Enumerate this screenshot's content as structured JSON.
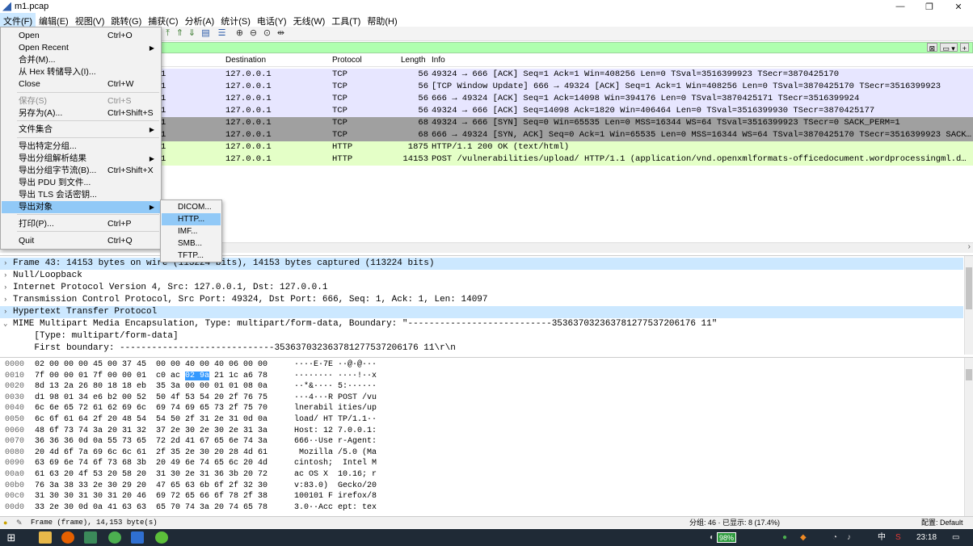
{
  "window": {
    "title": "m1.pcap"
  },
  "menubar": [
    "文件(F)",
    "编辑(E)",
    "视图(V)",
    "跳转(G)",
    "捕获(C)",
    "分析(A)",
    "统计(S)",
    "电话(Y)",
    "无线(W)",
    "工具(T)",
    "帮助(H)"
  ],
  "packet_list": {
    "columns": {
      "destination": "Destination",
      "protocol": "Protocol",
      "length": "Length",
      "info": "Info"
    },
    "rows": [
      {
        "frag": "1",
        "destination": "127.0.0.1",
        "protocol": "TCP",
        "length": "56",
        "info": "49324 → 666 [ACK] Seq=1 Ack=1 Win=408256 Len=0 TSval=3516399923 TSecr=3870425170",
        "color": "#e7e6ff"
      },
      {
        "frag": "1",
        "destination": "127.0.0.1",
        "protocol": "TCP",
        "length": "56",
        "info": "[TCP Window Update] 666 → 49324 [ACK] Seq=1 Ack=1 Win=408256 Len=0 TSval=3870425170 TSecr=3516399923",
        "color": "#e7e6ff"
      },
      {
        "frag": "1",
        "destination": "127.0.0.1",
        "protocol": "TCP",
        "length": "56",
        "info": "666 → 49324 [ACK] Seq=1 Ack=14098 Win=394176 Len=0 TSval=3870425171 TSecr=3516399924",
        "color": "#e7e6ff"
      },
      {
        "frag": "1",
        "destination": "127.0.0.1",
        "protocol": "TCP",
        "length": "56",
        "info": "49324 → 666 [ACK] Seq=14098 Ack=1820 Win=406464 Len=0 TSval=3516399930 TSecr=3870425177",
        "color": "#e7e6ff"
      },
      {
        "frag": "1",
        "destination": "127.0.0.1",
        "protocol": "TCP",
        "length": "68",
        "info": "49324 → 666 [SYN] Seq=0 Win=65535 Len=0 MSS=16344 WS=64 TSval=3516399923 TSecr=0 SACK_PERM=1",
        "color": "#a0a0a0"
      },
      {
        "frag": "1",
        "destination": "127.0.0.1",
        "protocol": "TCP",
        "length": "68",
        "info": "666 → 49324 [SYN, ACK] Seq=0 Ack=1 Win=65535 Len=0 MSS=16344 WS=64 TSval=3870425170 TSecr=3516399923 SACK…",
        "color": "#a0a0a0"
      },
      {
        "frag": "1",
        "destination": "127.0.0.1",
        "protocol": "HTTP",
        "length": "1875",
        "info": "HTTP/1.1 200 OK  (text/html)",
        "color": "#e4ffc7"
      },
      {
        "frag": "1",
        "destination": "127.0.0.1",
        "protocol": "HTTP",
        "length": "14153",
        "info": "POST /vulnerabilities/upload/ HTTP/1.1  (application/vnd.openxmlformats-officedocument.wordprocessingml.d…",
        "color": "#e4ffc7"
      }
    ]
  },
  "details": {
    "rows": [
      {
        "arrow": "›",
        "text": "Frame 43: 14153 bytes on wire (113224 bits), 14153 bytes captured (113224 bits)",
        "selected": true
      },
      {
        "arrow": "›",
        "text": "Null/Loopback",
        "selected": false
      },
      {
        "arrow": "›",
        "text": "Internet Protocol Version 4, Src: 127.0.0.1, Dst: 127.0.0.1",
        "selected": false
      },
      {
        "arrow": "›",
        "text": "Transmission Control Protocol, Src Port: 49324, Dst Port: 666, Seq: 1, Ack: 1, Len: 14097",
        "selected": false
      },
      {
        "arrow": "›",
        "text": "Hypertext Transfer Protocol",
        "selected": true
      },
      {
        "arrow": "⌄",
        "text": "MIME Multipart Media Encapsulation, Type: multipart/form-data, Boundary: \"---------------------------353637032363781277537206176 11\"",
        "selected": false
      },
      {
        "arrow": "",
        "text": "    [Type: multipart/form-data]",
        "selected": false
      },
      {
        "arrow": "",
        "text": "    First boundary: -----------------------------353637032363781277537206176 11\\r\\n",
        "selected": false
      }
    ]
  },
  "bytes": {
    "rows": [
      {
        "off": "0000",
        "hex": "02 00 00 00 45 00 37 45  00 00 40 00 40 06 00 00",
        "asc": "····E·7E ··@·@···"
      },
      {
        "off": "0010",
        "hex": "7f 00 00 01 7f 00 00 01  c0 ac 02 9a 21 1c a6 78",
        "asc": "········ ····!··x"
      },
      {
        "off": "0020",
        "hex": "8d 13 2a 26 80 18 18 eb  35 3a 00 00 01 01 08 0a",
        "asc": "··*&···· 5:······"
      },
      {
        "off": "0030",
        "hex": "d1 98 01 34 e6 b2 00 52  50 4f 53 54 20 2f 76 75",
        "asc": "···4···R POST /vu"
      },
      {
        "off": "0040",
        "hex": "6c 6e 65 72 61 62 69 6c  69 74 69 65 73 2f 75 70",
        "asc": "lnerabil ities/up"
      },
      {
        "off": "0050",
        "hex": "6c 6f 61 64 2f 20 48 54  54 50 2f 31 2e 31 0d 0a",
        "asc": "load/ HT TP/1.1··"
      },
      {
        "off": "0060",
        "hex": "48 6f 73 74 3a 20 31 32  37 2e 30 2e 30 2e 31 3a",
        "asc": "Host: 12 7.0.0.1:"
      },
      {
        "off": "0070",
        "hex": "36 36 36 0d 0a 55 73 65  72 2d 41 67 65 6e 74 3a",
        "asc": "666··Use r-Agent:"
      },
      {
        "off": "0080",
        "hex": "20 4d 6f 7a 69 6c 6c 61  2f 35 2e 30 20 28 4d 61",
        "asc": " Mozilla /5.0 (Ma"
      },
      {
        "off": "0090",
        "hex": "63 69 6e 74 6f 73 68 3b  20 49 6e 74 65 6c 20 4d",
        "asc": "cintosh;  Intel M"
      },
      {
        "off": "00a0",
        "hex": "61 63 20 4f 53 20 58 20  31 30 2e 31 36 3b 20 72",
        "asc": "ac OS X  10.16; r"
      },
      {
        "off": "00b0",
        "hex": "76 3a 38 33 2e 30 29 20  47 65 63 6b 6f 2f 32 30",
        "asc": "v:83.0)  Gecko/20"
      },
      {
        "off": "00c0",
        "hex": "31 30 30 31 30 31 20 46  69 72 65 66 6f 78 2f 38",
        "asc": "100101 F irefox/8"
      },
      {
        "off": "00d0",
        "hex": "33 2e 30 0d 0a 41 63 63  65 70 74 3a 20 74 65 78",
        "asc": "3.0··Acc ept: tex"
      }
    ]
  },
  "statusbar": {
    "frame": "Frame (frame), 14,153 byte(s)",
    "stats": "分组: 46 · 已显示: 8 (17.4%)",
    "profile": "配置: Default"
  },
  "taskbar": {
    "battery": "98%",
    "ime": "中",
    "time": "23:18"
  },
  "file_menu": {
    "items": [
      {
        "label": "Open",
        "shortcut": "Ctrl+O"
      },
      {
        "label": "Open Recent",
        "shortcut": "",
        "submenu": true
      },
      {
        "label": "合并(M)...",
        "shortcut": ""
      },
      {
        "label": "从 Hex 转储导入(I)...",
        "shortcut": ""
      },
      {
        "label": "Close",
        "shortcut": "Ctrl+W"
      },
      {
        "label": "保存(S)",
        "shortcut": "Ctrl+S",
        "disabled": true
      },
      {
        "label": "另存为(A)...",
        "shortcut": "Ctrl+Shift+S"
      },
      {
        "label": "文件集合",
        "shortcut": "",
        "submenu": true
      },
      {
        "label": "导出特定分组...",
        "shortcut": ""
      },
      {
        "label": "导出分组解析结果",
        "shortcut": "",
        "submenu": true
      },
      {
        "label": "导出分组字节流(B)...",
        "shortcut": "Ctrl+Shift+X"
      },
      {
        "label": "导出 PDU 到文件...",
        "shortcut": ""
      },
      {
        "label": "导出 TLS 会话密钥...",
        "shortcut": ""
      },
      {
        "label": "导出对象",
        "shortcut": "",
        "submenu": true
      },
      {
        "label": "打印(P)...",
        "shortcut": "Ctrl+P"
      },
      {
        "label": "Quit",
        "shortcut": "Ctrl+Q"
      }
    ]
  },
  "export_objects_menu": [
    "DICOM...",
    "HTTP...",
    "IMF...",
    "SMB...",
    "TFTP..."
  ]
}
